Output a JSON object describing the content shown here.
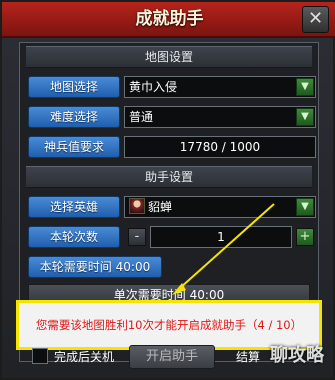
{
  "window": {
    "title": "成就助手",
    "close_label": "✕"
  },
  "map_settings": {
    "header": "地图设置",
    "map_select_label": "地图选择",
    "map_select_value": "黄巾入侵",
    "difficulty_label": "难度选择",
    "difficulty_value": "普通",
    "weapon_label": "神兵值要求",
    "weapon_value": "17780 / 1000"
  },
  "helper_settings": {
    "header": "助手设置",
    "hero_label": "选择英雄",
    "hero_value": "貂蝉",
    "rounds_label": "本轮次数",
    "rounds_value": "1",
    "minus_label": "-",
    "plus_label": "+",
    "round_time_label": "本轮需要时间",
    "round_time_value": "40:00",
    "single_time_label": "单次需要时间",
    "single_time_value": "40:00"
  },
  "notice": {
    "text": "您需要该地图胜利10次才能开启成就助手（4 / 10）"
  },
  "bottom": {
    "shutdown_label": "完成后关机",
    "start_button": "开启助手",
    "end_label": "结算"
  },
  "watermark": {
    "text": "聊攻略"
  },
  "colors": {
    "title_red": "#b5241c",
    "label_blue": "#2f74c6",
    "notice_border": "#f5e400",
    "notice_text": "#e01818",
    "arrow_yellow": "#f5e400"
  },
  "icons": {
    "dropdown": "chevron-down-icon",
    "close": "close-icon"
  }
}
